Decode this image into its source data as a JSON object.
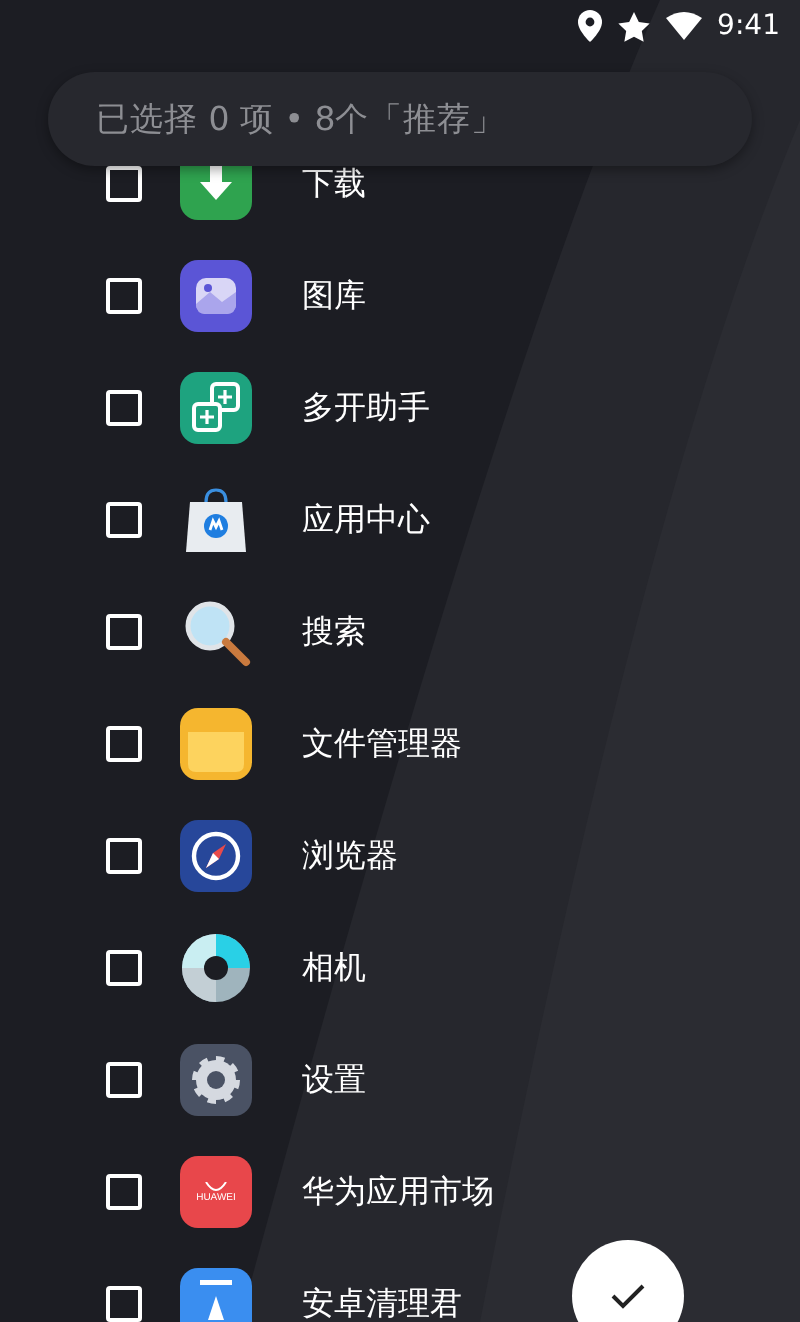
{
  "status_bar": {
    "time": "9:41"
  },
  "search": {
    "placeholder": "已选择 0 项 • 8个「推荐」"
  },
  "apps": [
    {
      "kind": "download",
      "label": "下载",
      "checked": false
    },
    {
      "kind": "gallery",
      "label": "图库",
      "checked": false
    },
    {
      "kind": "dual",
      "label": "多开助手",
      "checked": false
    },
    {
      "kind": "store",
      "label": "应用中心",
      "checked": false
    },
    {
      "kind": "search",
      "label": "搜索",
      "checked": false
    },
    {
      "kind": "folder",
      "label": "文件管理器",
      "checked": false
    },
    {
      "kind": "browser",
      "label": "浏览器",
      "checked": false
    },
    {
      "kind": "camera",
      "label": "相机",
      "checked": false
    },
    {
      "kind": "settings",
      "label": "设置",
      "checked": false
    },
    {
      "kind": "huawei",
      "label": "华为应用市场",
      "icon_text": "HUAWEI",
      "checked": false
    },
    {
      "kind": "cleaner",
      "label": "安卓清理君",
      "checked": false
    }
  ]
}
